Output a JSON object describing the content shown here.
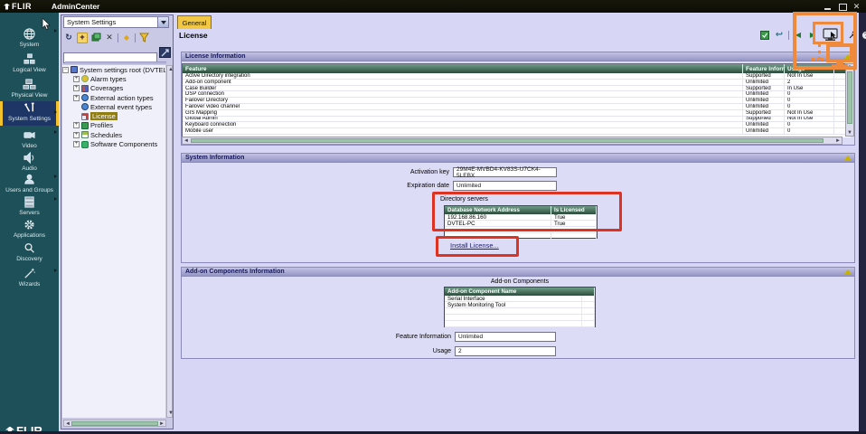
{
  "window": {
    "brand": "FLIR",
    "title": "AdminCenter"
  },
  "sidebar": {
    "items": [
      {
        "label": "System",
        "icon": "globe-icon"
      },
      {
        "label": "Logical View",
        "icon": "logical-view-icon"
      },
      {
        "label": "Physical View",
        "icon": "physical-view-icon"
      },
      {
        "label": "System Settings",
        "icon": "tools-icon",
        "active": true
      },
      {
        "label": "Video",
        "icon": "video-camera-icon"
      },
      {
        "label": "Audio",
        "icon": "speaker-icon"
      },
      {
        "label": "Users and Groups",
        "icon": "user-icon"
      },
      {
        "label": "Servers",
        "icon": "servers-icon"
      },
      {
        "label": "Applications",
        "icon": "gear-icon"
      },
      {
        "label": "Discovery",
        "icon": "magnifier-icon"
      },
      {
        "label": "Wizards",
        "icon": "wand-icon"
      }
    ],
    "footer_brand": "FLIR"
  },
  "explorer": {
    "scope_dropdown": "System Settings",
    "search_value": "",
    "tree": {
      "root": "System settings root (DVTEL-PC",
      "items": [
        {
          "label": "Alarm types"
        },
        {
          "label": "Coverages"
        },
        {
          "label": "External action types"
        },
        {
          "label": "External event types"
        },
        {
          "label": "License",
          "selected": true
        },
        {
          "label": "Profiles"
        },
        {
          "label": "Schedules"
        },
        {
          "label": "Software Components"
        }
      ]
    }
  },
  "content": {
    "tab": "General",
    "page_title": "License",
    "license_info": {
      "title": "License Information",
      "columns": [
        "Feature",
        "Feature Informa...",
        "Usage"
      ],
      "rows": [
        [
          "Active Directory integration",
          "Supported",
          "Not In Use"
        ],
        [
          "Add-on component",
          "Unlimited",
          "2"
        ],
        [
          "Case Builder",
          "Supported",
          "In Use"
        ],
        [
          "DSP connection",
          "Unlimited",
          "0"
        ],
        [
          "Failover Directory",
          "Unlimited",
          "0"
        ],
        [
          "Failover video channel",
          "Unlimited",
          "0"
        ],
        [
          "GIS Mapping",
          "Supported",
          "Not In Use"
        ],
        [
          "Global Admin",
          "Supported",
          "Not In Use"
        ],
        [
          "Keyboard connection",
          "Unlimited",
          "0"
        ],
        [
          "Mobile user",
          "Unlimited",
          "0"
        ]
      ]
    },
    "system_info": {
      "title": "System Information",
      "activation_key_label": "Activation key",
      "activation_key": "29M4E-MVBD4-KV83S-U7CK4-5LEBX",
      "expiration_label": "Expiration date",
      "expiration_value": "Unlimited",
      "directory_servers_label": "Directory servers",
      "directory_columns": [
        "Database Network Address",
        "Is Licensed"
      ],
      "directory_rows": [
        [
          "192.168.86.160",
          "True"
        ],
        [
          "DVTEL-PC",
          "True"
        ]
      ],
      "install_license_label": "Install License..."
    },
    "addon_info": {
      "title": "Add-on Components Information",
      "components_label": "Add-on Components",
      "column_header": "Add-on Component Name",
      "rows": [
        "Serial Interface",
        "System Monitoring Tool"
      ],
      "feature_info_label": "Feature Information",
      "feature_info_value": "Unlimited",
      "usage_label": "Usage",
      "usage_value": "2"
    }
  },
  "colors": {
    "accent_yellow": "#f2c12e",
    "annotation_red": "#dd3322",
    "annotation_orange": "#ef8a3d",
    "table_header_green": "#2c4c3c",
    "sidebar_teal": "#1e5059"
  }
}
